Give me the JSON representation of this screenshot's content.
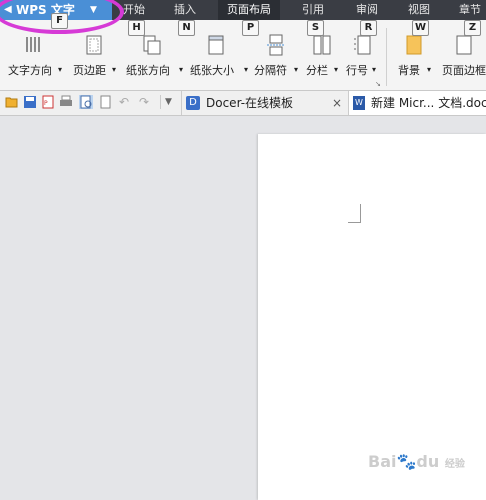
{
  "app": {
    "title": "WPS 文字"
  },
  "tabs": [
    {
      "label": "开始",
      "key": "H"
    },
    {
      "label": "插入",
      "key": "N"
    },
    {
      "label": "页面布局",
      "key": "P"
    },
    {
      "label": "引用",
      "key": "S"
    },
    {
      "label": "审阅",
      "key": "R"
    },
    {
      "label": "视图",
      "key": "W"
    },
    {
      "label": "章节",
      "key": "Z"
    }
  ],
  "app_key": "F",
  "ribbon": {
    "text_direction": "文字方向",
    "margins": "页边距",
    "orientation": "纸张方向",
    "size": "纸张大小",
    "breaks": "分隔符",
    "columns": "分栏",
    "line_numbers": "行号",
    "background": "背景",
    "page_border": "页面边框"
  },
  "doc_tabs": [
    {
      "label": "Docer-在线模板"
    },
    {
      "label": "新建 Micr... 文档.doc"
    }
  ],
  "close_symbol": "×",
  "watermark": {
    "text": "Bai",
    "sub": "经验",
    "tail": "du"
  },
  "colors": {
    "accent": "#4a8fd6",
    "highlight": "#d63ad6",
    "tabbar": "#3a3d44"
  }
}
